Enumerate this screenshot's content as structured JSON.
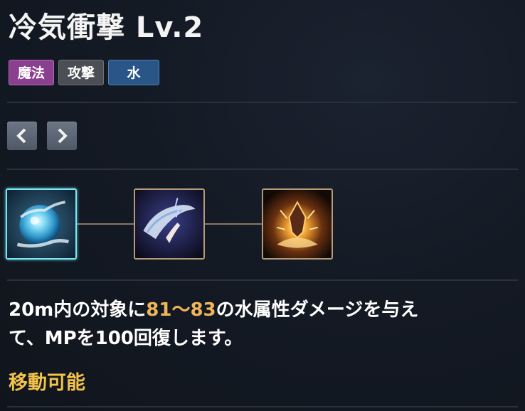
{
  "skill": {
    "title": "冷気衝撃 Lv.2",
    "tags": [
      "魔法",
      "攻撃",
      "水"
    ],
    "description": {
      "part1": "20m内の対象に",
      "damage": "81〜83",
      "part2": "の水属性ダメージを与え",
      "part3": "て、MPを100回復します。"
    },
    "condition": "移動可能"
  },
  "navigation": {
    "prev_icon": "chevron-left-icon",
    "next_icon": "chevron-right-icon"
  },
  "skill_tree": [
    {
      "name": "water-orb-icon",
      "state": "active"
    },
    {
      "name": "water-wave-icon",
      "state": "normal"
    },
    {
      "name": "fire-burst-icon",
      "state": "normal"
    }
  ],
  "colors": {
    "background": "#141a24",
    "magic_tag": "#8b3f8f",
    "attack_tag": "#4b4f55",
    "water_tag": "#2a5687",
    "highlight": "#f0b45a",
    "condition": "#f3c34a",
    "active_border": "#7fe6f0"
  }
}
